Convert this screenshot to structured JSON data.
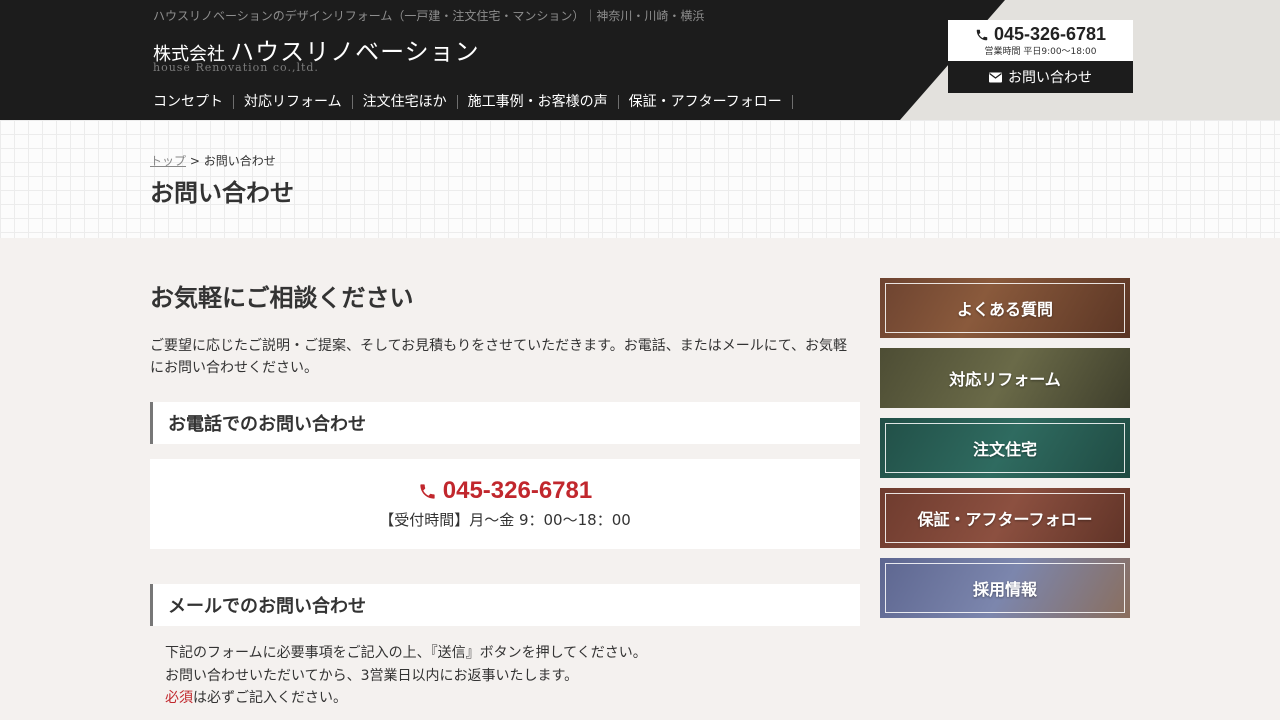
{
  "header": {
    "tagline": "ハウスリノベーションのデザインリフォーム（一戸建・注文住宅・マンション）｜神奈川・川崎・横浜",
    "logo_company_prefix": "株式会社",
    "logo_name": "ハウスリノベーション",
    "logo_sub": "house Renovation co.,ltd.",
    "tel": "045-326-6781",
    "hours": "営業時間 平日9:00〜18:00",
    "contact_label": "お問い合わせ",
    "nav": [
      "コンセプト",
      "対応リフォーム",
      "注文住宅ほか",
      "施工事例・お客様の声",
      "保証・アフターフォロー"
    ]
  },
  "titleband": {
    "breadcrumb_home": "トップ",
    "breadcrumb_sep": " > ",
    "breadcrumb_current": "お問い合わせ",
    "title": "お問い合わせ"
  },
  "main": {
    "heading": "お気軽にご相談ください",
    "lead": "ご要望に応じたご説明・ご提案、そしてお見積もりをさせていただきます。お電話、またはメールにて、お気軽にお問い合わせください。",
    "phone_section_title": "お電話でのお問い合わせ",
    "phone_number": "045-326-6781",
    "phone_hours": "【受付時間】月〜金 9：00〜18：00",
    "mail_section_title": "メールでのお問い合わせ",
    "form_intro_line1": "下記のフォームに必要事項をご記入の上、『送信』ボタンを押してください。",
    "form_intro_line2": "お問い合わせいただいてから、3営業日以内にお返事いたします。",
    "required_word": "必須",
    "required_note": "は必ずご記入ください。"
  },
  "sidebar": {
    "items": [
      "よくある質問",
      "対応リフォーム",
      "注文住宅",
      "保証・アフターフォロー",
      "採用情報"
    ]
  },
  "colors": {
    "header_bg": "#1c1c1c",
    "accent_red": "#c1272d",
    "page_bg": "#f4f1ef"
  }
}
